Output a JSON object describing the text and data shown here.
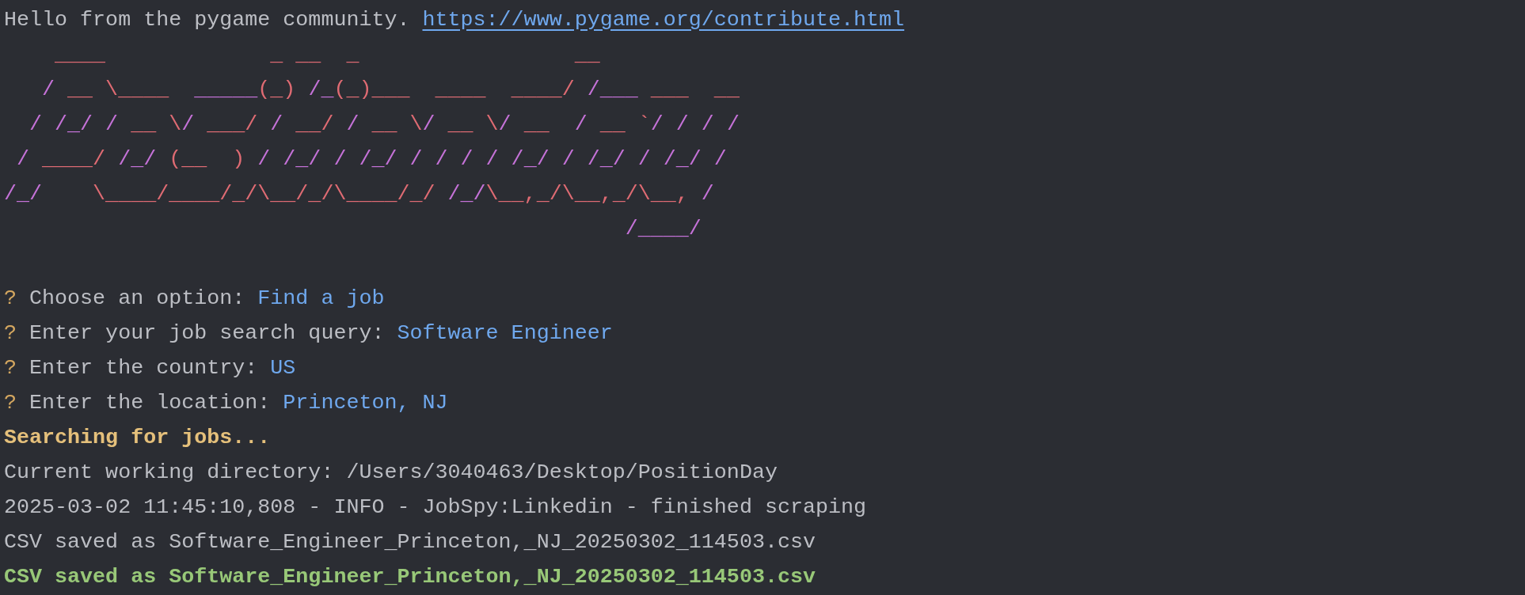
{
  "greeting": {
    "text": "Hello from the pygame community.",
    "link": "https://www.pygame.org/contribute.html"
  },
  "banner": [
    {
      "runs": [
        {
          "text": "    ____             _ __  _                 __",
          "color": "#df6b73"
        }
      ]
    },
    {
      "runs": [
        {
          "text": "   /",
          "color": "#c572d8"
        },
        {
          "text": " __ \\____  ",
          "color": "#df6b73"
        },
        {
          "text": "_____",
          "color": "#c572d8"
        },
        {
          "text": "(_) ",
          "color": "#df6b73"
        },
        {
          "text": "/_",
          "color": "#c572d8"
        },
        {
          "text": "(_)___  ____  ____/ ",
          "color": "#df6b73"
        },
        {
          "text": "/___",
          "color": "#c572d8"
        },
        {
          "text": " ___  __",
          "color": "#df6b73"
        }
      ]
    },
    {
      "runs": [
        {
          "text": "  / /_/ /",
          "color": "#c572d8"
        },
        {
          "text": " __ \\",
          "color": "#df6b73"
        },
        {
          "text": "/",
          "color": "#c572d8"
        },
        {
          "text": " ___/ ",
          "color": "#df6b73"
        },
        {
          "text": "/",
          "color": "#c572d8"
        },
        {
          "text": " __/ ",
          "color": "#df6b73"
        },
        {
          "text": "/",
          "color": "#c572d8"
        },
        {
          "text": " __ \\",
          "color": "#df6b73"
        },
        {
          "text": "/",
          "color": "#c572d8"
        },
        {
          "text": " __ \\",
          "color": "#df6b73"
        },
        {
          "text": "/",
          "color": "#c572d8"
        },
        {
          "text": " __  ",
          "color": "#df6b73"
        },
        {
          "text": "/",
          "color": "#c572d8"
        },
        {
          "text": " __ `",
          "color": "#df6b73"
        },
        {
          "text": "/ / / /",
          "color": "#c572d8"
        }
      ]
    },
    {
      "runs": [
        {
          "text": " / ",
          "color": "#c572d8"
        },
        {
          "text": "____/",
          "color": "#df6b73"
        },
        {
          "text": " /_/ ",
          "color": "#c572d8"
        },
        {
          "text": "(__  )",
          "color": "#df6b73"
        },
        {
          "text": " / /_/ / /_/ / / / / /_/ / /_/ / /_/ /",
          "color": "#c572d8"
        }
      ]
    },
    {
      "runs": [
        {
          "text": "/_/",
          "color": "#c572d8"
        },
        {
          "text": "    \\____/____/_/\\__/_/\\____/_/ ",
          "color": "#df6b73"
        },
        {
          "text": "/_/",
          "color": "#c572d8"
        },
        {
          "text": "\\__,_/\\__,_/\\__,",
          "color": "#df6b73"
        },
        {
          "text": " /",
          "color": "#c572d8"
        }
      ]
    },
    {
      "runs": [
        {
          "text": "                                                 /____/",
          "color": "#c572d8"
        }
      ]
    }
  ],
  "prompts": [
    {
      "marker": "?",
      "question": "Choose an option:",
      "answer": "Find a job"
    },
    {
      "marker": "?",
      "question": "Enter your job search query:",
      "answer": "Software Engineer"
    },
    {
      "marker": "?",
      "question": "Enter the country:",
      "answer": "US"
    },
    {
      "marker": "?",
      "question": "Enter the location:",
      "answer": "Princeton, NJ"
    }
  ],
  "log": [
    {
      "kind": "status",
      "text": "Searching for jobs..."
    },
    {
      "kind": "plain",
      "text": "Current working directory: /Users/3040463/Desktop/PositionDay"
    },
    {
      "kind": "plain",
      "text": "2025-03-02 11:45:10,808 - INFO - JobSpy:Linkedin - finished scraping"
    },
    {
      "kind": "plain",
      "text": "CSV saved as Software_Engineer_Princeton,_NJ_20250302_114503.csv"
    },
    {
      "kind": "success",
      "text": "CSV saved as Software_Engineer_Princeton,_NJ_20250302_114503.csv"
    }
  ]
}
